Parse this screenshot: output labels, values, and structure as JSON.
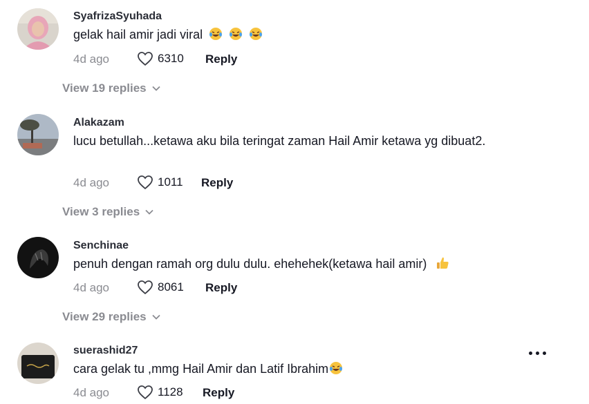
{
  "comments": [
    {
      "username": "SyafrizaSyuhada",
      "text": "gelak hail amir jadi viral",
      "emojis": [
        "laughing-tears-emoji",
        "laughing-tears-emoji",
        "laughing-tears-emoji"
      ],
      "time": "4d ago",
      "likes": "6310",
      "reply_label": "Reply",
      "view_replies": "View 19 replies"
    },
    {
      "username": "Alakazam",
      "text": "lucu betullah...ketawa aku bila teringat zaman Hail Amir ketawa yg dibuat2.",
      "time": "4d ago",
      "likes": "1011",
      "reply_label": "Reply",
      "view_replies": "View 3 replies"
    },
    {
      "username": "Senchinae",
      "text": "penuh dengan ramah org dulu dulu. ehehehek(ketawa hail amir)",
      "emojis": [
        "thumbs-up-emoji"
      ],
      "time": "4d ago",
      "likes": "8061",
      "reply_label": "Reply",
      "view_replies": "View 29 replies"
    },
    {
      "username": "suerashid27",
      "text": "cara gelak tu ,mmg Hail Amir dan Latif Ibrahim",
      "emojis": [
        "laughing-tears-emoji"
      ],
      "time": "4d ago",
      "likes": "1128",
      "reply_label": "Reply"
    }
  ],
  "icons": {
    "like": "heart-outline-icon",
    "expand": "chevron-down-icon",
    "more": "more-horizontal-icon"
  },
  "colors": {
    "primary_text": "#161823",
    "secondary_text": "#8a8b91",
    "emoji_face": "#f7c33d"
  }
}
